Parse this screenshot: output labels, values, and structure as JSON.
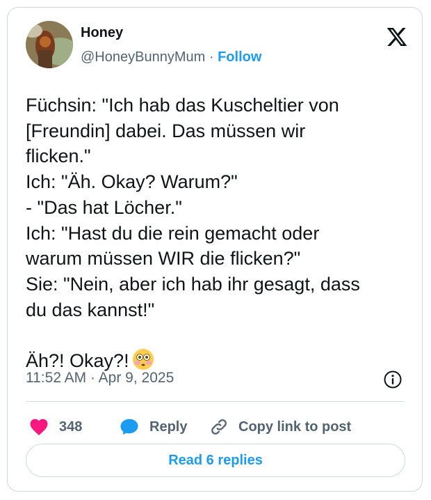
{
  "author": {
    "display_name": "Honey",
    "handle": "@HoneyBunnyMum",
    "separator": "·",
    "follow_label": "Follow"
  },
  "tweet": {
    "text": "Füchsin: \"Ich hab das Kuscheltier von\n[Freundin] dabei. Das müssen wir\nflicken.\"\nIch: \"Äh. Okay? Warum?\"\n- \"Das hat Löcher.\"\nIch: \"Hast du die rein gemacht oder\nwarum müssen WIR die flicken?\"\nSie: \"Nein, aber ich hab ihr gesagt, dass\ndu das kannst!\"\n\nÄh?! Okay?!",
    "emoji": "flushed-face",
    "timestamp": "11:52 AM · Apr 9, 2025"
  },
  "actions": {
    "like_count": "348",
    "reply_label": "Reply",
    "copy_link_label": "Copy link to post"
  },
  "read_replies_label": "Read 6 replies",
  "icons": [
    "x-logo-icon",
    "info-icon",
    "heart-icon",
    "reply-bubble-icon",
    "link-icon"
  ],
  "colors": {
    "accent": "#1d9bf0",
    "like": "#f91880",
    "secondary_text": "#536471",
    "border": "#cfd9de"
  }
}
